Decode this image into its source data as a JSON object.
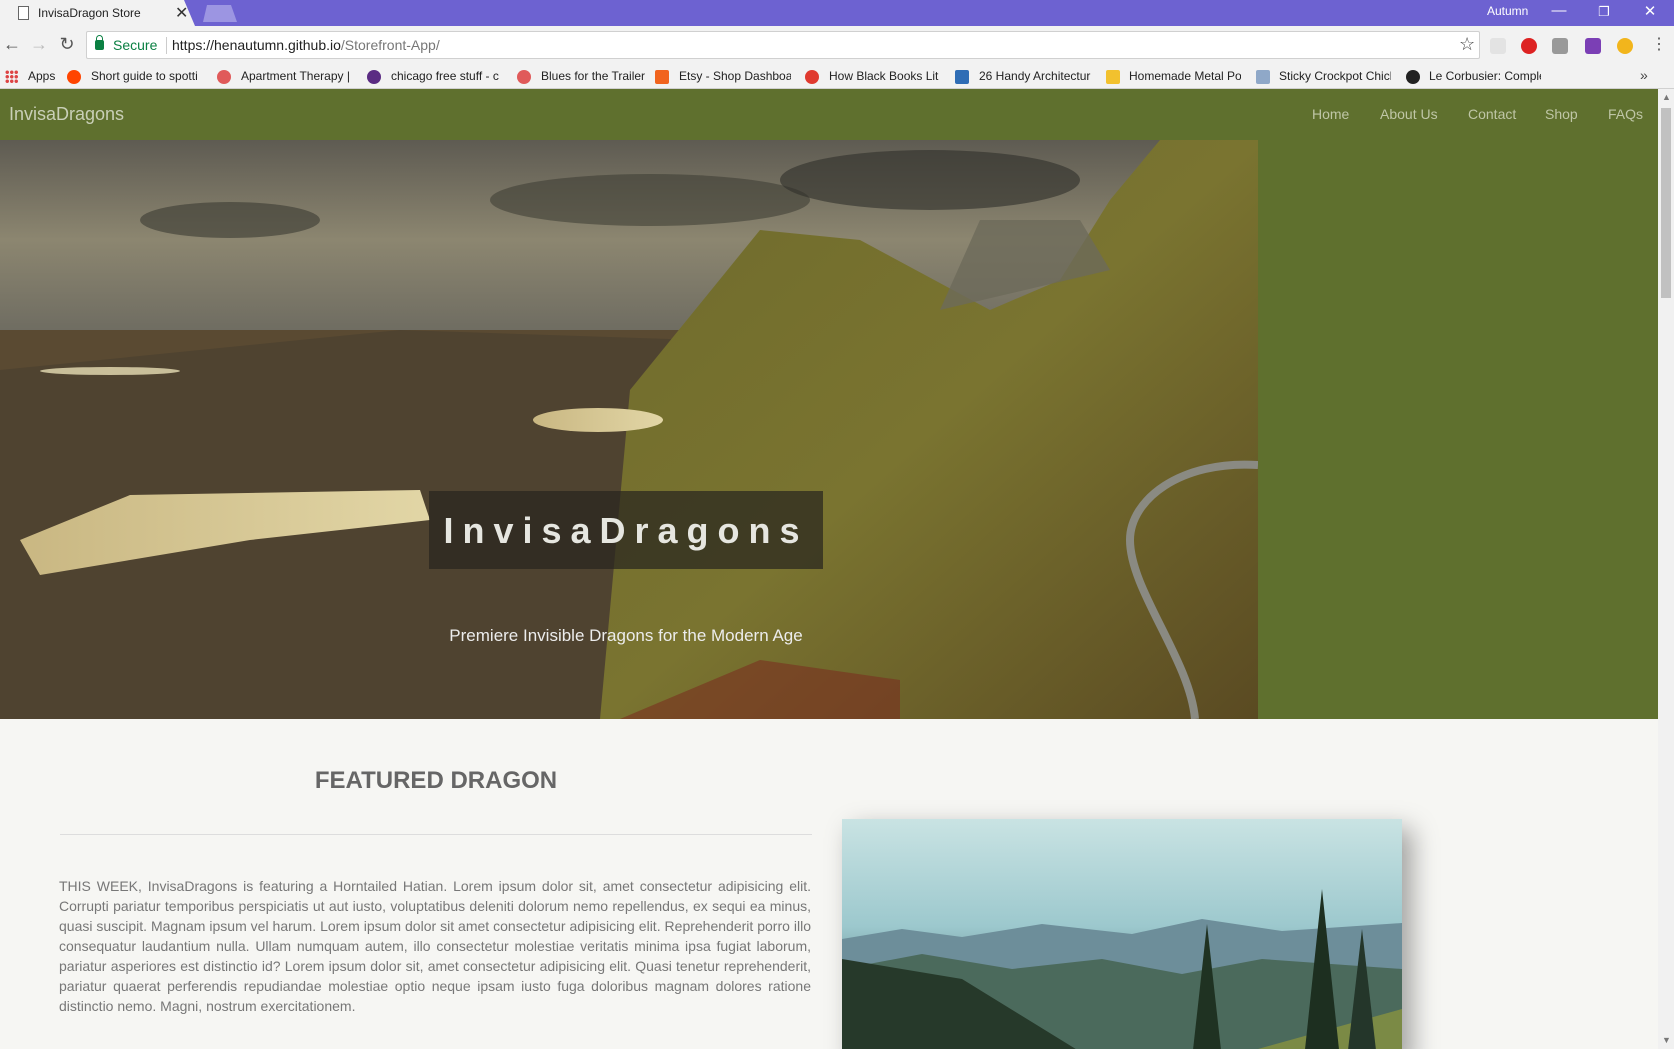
{
  "browser": {
    "tab_title": "InvisaDragon Store",
    "tab_close": "✕",
    "profile_name": "Autumn",
    "window_controls": {
      "minimize": "—",
      "restore": "❐",
      "close": "✕"
    },
    "secure_label": "Secure",
    "url_host": "https://henautumn.github.io",
    "url_path": "/Storefront-App/",
    "bookmarks": [
      {
        "label": "Apps",
        "icon": "apps-grid-icon",
        "color": "#d44"
      },
      {
        "label": "Short guide to spotti",
        "icon": "reddit-icon",
        "color": "#ff4500"
      },
      {
        "label": "Apartment Therapy |",
        "icon": "apartment-therapy-icon",
        "color": "#e05a5a"
      },
      {
        "label": "chicago free stuff - c",
        "icon": "peace-icon",
        "color": "#5b2c83"
      },
      {
        "label": "Blues for the Trailer",
        "icon": "apartment-therapy-icon",
        "color": "#e05a5a"
      },
      {
        "label": "Etsy - Shop Dashboa",
        "icon": "etsy-icon",
        "color": "#f1641e"
      },
      {
        "label": "How Black Books Lit",
        "icon": "flame-icon",
        "color": "#e03a2f"
      },
      {
        "label": "26 Handy Architectur",
        "icon": "shield-icon",
        "color": "#2f6db5"
      },
      {
        "label": "Homemade Metal Po",
        "icon": "instructables-icon",
        "color": "#f2c12e"
      },
      {
        "label": "Sticky Crockpot Chick",
        "icon": "house-icon",
        "color": "#8fa8c8"
      },
      {
        "label": "Le Corbusier: Comple",
        "icon": "globe-icon",
        "color": "#222"
      }
    ],
    "bookmarks_more": "»"
  },
  "navbar": {
    "brand": "InvisaDragons",
    "links": [
      "Home",
      "About Us",
      "Contact",
      "Shop",
      "FAQs"
    ]
  },
  "hero": {
    "title": "InvisaDragons",
    "subtitle": "Premiere Invisible Dragons for the Modern Age"
  },
  "featured": {
    "heading": "FEATURED DRAGON",
    "body": "THIS WEEK, InvisaDragons is featuring a Horntailed Hatian. Lorem ipsum dolor sit, amet consectetur adipisicing elit. Corrupti pariatur temporibus perspiciatis ut aut iusto, voluptatibus deleniti dolorum nemo repellendus, ex sequi ea minus, quasi suscipit. Magnam ipsum vel harum. Lorem ipsum dolor sit amet consectetur adipisicing elit. Reprehenderit porro illo consequatur laudantium nulla. Ullam numquam autem, illo consectetur molestiae veritatis minima ipsa fugiat laborum, pariatur asperiores est distinctio id? Lorem ipsum dolor sit, amet consectetur adipisicing elit. Quasi tenetur reprehenderit, pariatur quaerat perferendis repudiandae molestiae optio neque ipsam iusto fuga doloribus magnam dolores ratione distinctio nemo. Magni, nostrum exercitationem."
  },
  "colors": {
    "navbar": "#5f702e",
    "titlebar": "#6d62d1",
    "secure": "#0b8043"
  }
}
